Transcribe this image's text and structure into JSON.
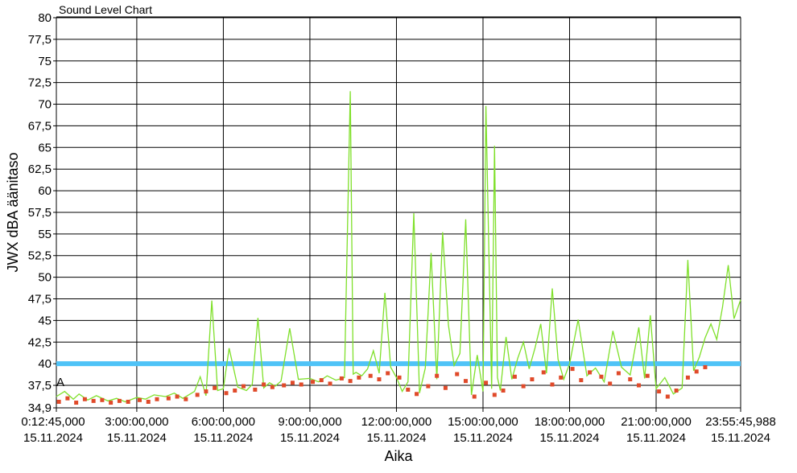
{
  "chart_data": {
    "type": "line",
    "title": "Sound Level Chart",
    "xlabel": "Aika",
    "ylabel": "JWX dBA äänitaso",
    "ylim": [
      34.9,
      80
    ],
    "xlim_hours": [
      0.2125,
      23.9294
    ],
    "grid": true,
    "y_ticks": [
      "80",
      "77,5",
      "75",
      "72,5",
      "70",
      "67,5",
      "65",
      "62,5",
      "60",
      "57,5",
      "55",
      "52,5",
      "50",
      "47,5",
      "45",
      "42,5",
      "40",
      "37,5",
      "34,9"
    ],
    "x_ticks": [
      {
        "time": "0:12:45,000",
        "date": "15.11.2024",
        "hour": 0.2125
      },
      {
        "time": "3:00:00,000",
        "date": "15.11.2024",
        "hour": 3
      },
      {
        "time": "6:00:00,000",
        "date": "15.11.2024",
        "hour": 6
      },
      {
        "time": "9:00:00,000",
        "date": "15.11.2024",
        "hour": 9
      },
      {
        "time": "12:00:00,000",
        "date": "15.11.2024",
        "hour": 12
      },
      {
        "time": "15:00:00,000",
        "date": "15.11.2024",
        "hour": 15
      },
      {
        "time": "18:00:00,000",
        "date": "15.11.2024",
        "hour": 18
      },
      {
        "time": "21:00:00,000",
        "date": "15.11.2024",
        "hour": 21
      },
      {
        "time": "23:55:45,988",
        "date": "15.11.2024",
        "hour": 23.9294
      }
    ],
    "threshold": {
      "value": 40,
      "color": "#4fc3f7"
    },
    "threshold_label": "A",
    "series": [
      {
        "color": "#7fe02a",
        "style": "line",
        "x_hours": [
          0.21,
          0.5,
          0.8,
          1.0,
          1.3,
          1.6,
          2.0,
          2.3,
          2.6,
          3.0,
          3.3,
          3.6,
          4.0,
          4.3,
          4.6,
          5.0,
          5.2,
          5.4,
          5.6,
          5.8,
          6.0,
          6.2,
          6.5,
          6.8,
          7.0,
          7.2,
          7.4,
          7.6,
          7.8,
          8.0,
          8.3,
          8.6,
          9.0,
          9.3,
          9.6,
          9.9,
          10.2,
          10.4,
          10.5,
          10.6,
          10.8,
          11.0,
          11.2,
          11.4,
          11.6,
          11.8,
          12.0,
          12.2,
          12.4,
          12.6,
          12.8,
          13.0,
          13.2,
          13.4,
          13.6,
          13.8,
          14.0,
          14.2,
          14.4,
          14.6,
          14.8,
          15.0,
          15.1,
          15.3,
          15.4,
          15.5,
          15.6,
          15.8,
          16.0,
          16.2,
          16.4,
          16.6,
          16.8,
          17.0,
          17.2,
          17.4,
          17.6,
          17.8,
          18.0,
          18.3,
          18.6,
          18.9,
          19.2,
          19.5,
          19.8,
          20.1,
          20.4,
          20.6,
          20.8,
          21.0,
          21.3,
          21.6,
          21.9,
          22.1,
          22.3,
          22.5,
          22.7,
          22.9,
          23.1,
          23.3,
          23.5,
          23.7,
          23.93
        ],
        "y": [
          36.2,
          36.8,
          35.9,
          36.5,
          35.8,
          36.3,
          35.7,
          36.0,
          35.6,
          36.1,
          35.9,
          36.4,
          36.2,
          36.6,
          36.0,
          36.8,
          38.5,
          36.3,
          47.3,
          36.9,
          37.1,
          41.8,
          37.3,
          36.9,
          37.6,
          45.3,
          37.2,
          37.8,
          37.4,
          38.0,
          44.1,
          38.2,
          38.3,
          37.9,
          38.6,
          38.1,
          38.4,
          71.5,
          38.8,
          39.0,
          38.6,
          39.4,
          41.5,
          38.9,
          48.2,
          39.6,
          38.4,
          36.8,
          37.9,
          57.4,
          36.6,
          39.5,
          52.8,
          38.2,
          55.2,
          44.5,
          39.8,
          41.2,
          56.7,
          36.4,
          41.0,
          36.8,
          69.8,
          37.1,
          65.2,
          38.4,
          36.9,
          43.1,
          38.2,
          40.6,
          42.5,
          39.4,
          41.8,
          44.6,
          38.9,
          48.7,
          40.5,
          38.2,
          40.0,
          45.1,
          38.6,
          39.5,
          37.9,
          43.8,
          39.6,
          38.7,
          44.2,
          38.3,
          45.6,
          37.1,
          38.4,
          36.5,
          37.2,
          52.0,
          39.2,
          40.8,
          43.0,
          44.6,
          42.8,
          46.5,
          51.4,
          45.2,
          47.4
        ]
      },
      {
        "color": "#e04a2a",
        "style": "markers",
        "x_hours": [
          0.3,
          0.6,
          0.9,
          1.2,
          1.5,
          1.8,
          2.1,
          2.4,
          2.7,
          3.1,
          3.4,
          3.7,
          4.1,
          4.4,
          4.7,
          5.1,
          5.4,
          5.7,
          6.1,
          6.4,
          6.7,
          7.1,
          7.4,
          7.7,
          8.1,
          8.4,
          8.7,
          9.1,
          9.4,
          9.7,
          10.1,
          10.4,
          10.7,
          11.1,
          11.4,
          11.7,
          12.1,
          12.4,
          12.7,
          13.1,
          13.4,
          13.7,
          14.1,
          14.4,
          14.7,
          15.1,
          15.4,
          15.7,
          16.1,
          16.4,
          16.7,
          17.1,
          17.4,
          17.7,
          18.1,
          18.4,
          18.7,
          19.1,
          19.4,
          19.7,
          20.1,
          20.4,
          20.7,
          21.1,
          21.4,
          21.7,
          22.1,
          22.4,
          22.7
        ],
        "y": [
          35.6,
          36.0,
          35.5,
          35.9,
          35.7,
          35.8,
          35.5,
          35.7,
          35.6,
          35.8,
          35.6,
          35.9,
          36.0,
          36.2,
          35.9,
          36.4,
          36.8,
          37.2,
          36.6,
          36.9,
          37.4,
          37.0,
          37.6,
          37.3,
          37.5,
          37.8,
          37.6,
          37.9,
          38.1,
          37.7,
          38.3,
          38.0,
          38.4,
          38.6,
          38.2,
          38.9,
          38.4,
          37.0,
          36.5,
          37.4,
          38.6,
          37.2,
          38.8,
          38.0,
          36.2,
          37.8,
          36.4,
          36.9,
          38.5,
          37.4,
          38.2,
          39.0,
          37.6,
          38.4,
          39.4,
          38.1,
          39.0,
          38.5,
          37.7,
          38.9,
          38.2,
          37.5,
          38.6,
          36.8,
          36.2,
          36.9,
          38.4,
          39.1,
          39.6
        ]
      }
    ]
  }
}
